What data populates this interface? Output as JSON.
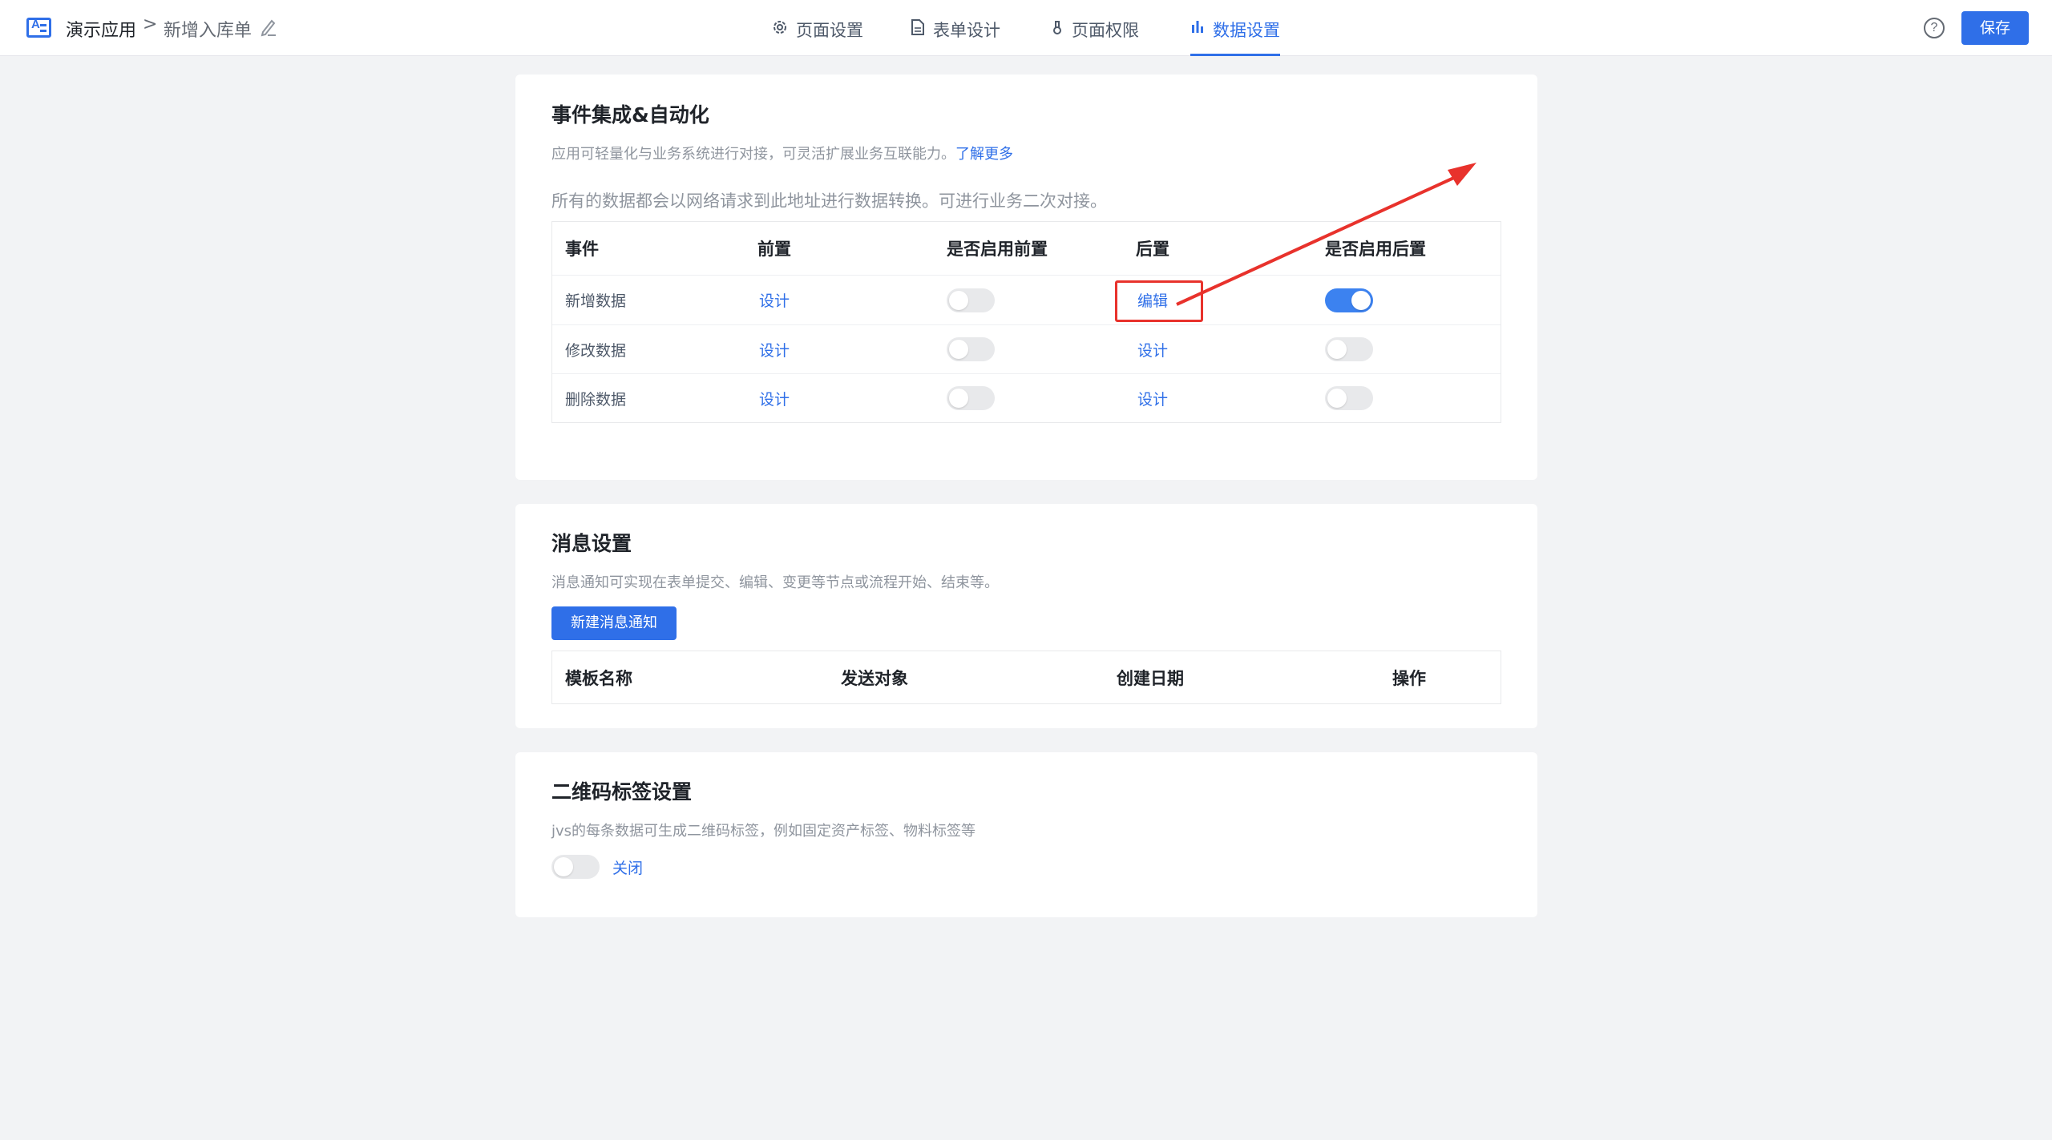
{
  "header": {
    "app_name": "演示应用",
    "separator": ">",
    "form_name": "新增入库单",
    "tabs": [
      {
        "label": "页面设置",
        "icon": "gear-icon"
      },
      {
        "label": "表单设计",
        "icon": "document-icon"
      },
      {
        "label": "页面权限",
        "icon": "lock-icon"
      },
      {
        "label": "数据设置",
        "icon": "bar-chart-icon",
        "active": true
      }
    ],
    "help_label": "?",
    "save_label": "保存"
  },
  "events_card": {
    "title": "事件集成&自动化",
    "desc": "应用可轻量化与业务系统进行对接，可灵活扩展业务互联能力。",
    "learn_more": "了解更多",
    "note": "所有的数据都会以网络请求到此地址进行数据转换。可进行业务二次对接。",
    "columns": [
      "事件",
      "前置",
      "是否启用前置",
      "后置",
      "是否启用后置"
    ],
    "rows": [
      {
        "event": "新增数据",
        "pre": "设计",
        "pre_enabled": false,
        "post": "编辑",
        "post_enabled": true
      },
      {
        "event": "修改数据",
        "pre": "设计",
        "pre_enabled": false,
        "post": "设计",
        "post_enabled": false
      },
      {
        "event": "删除数据",
        "pre": "设计",
        "pre_enabled": false,
        "post": "设计",
        "post_enabled": false
      }
    ]
  },
  "message_card": {
    "title": "消息设置",
    "desc": "消息通知可实现在表单提交、编辑、变更等节点或流程开始、结束等。",
    "new_button": "新建消息通知",
    "columns": [
      "模板名称",
      "发送对象",
      "创建日期",
      "操作"
    ]
  },
  "qr_card": {
    "title": "二维码标签设置",
    "desc": "jvs的每条数据可生成二维码标签，例如固定资产标签、物料标签等",
    "toggle_enabled": false,
    "toggle_label": "关闭"
  },
  "colors": {
    "accent": "#2f6fe8",
    "annotation": "#e8322c"
  }
}
